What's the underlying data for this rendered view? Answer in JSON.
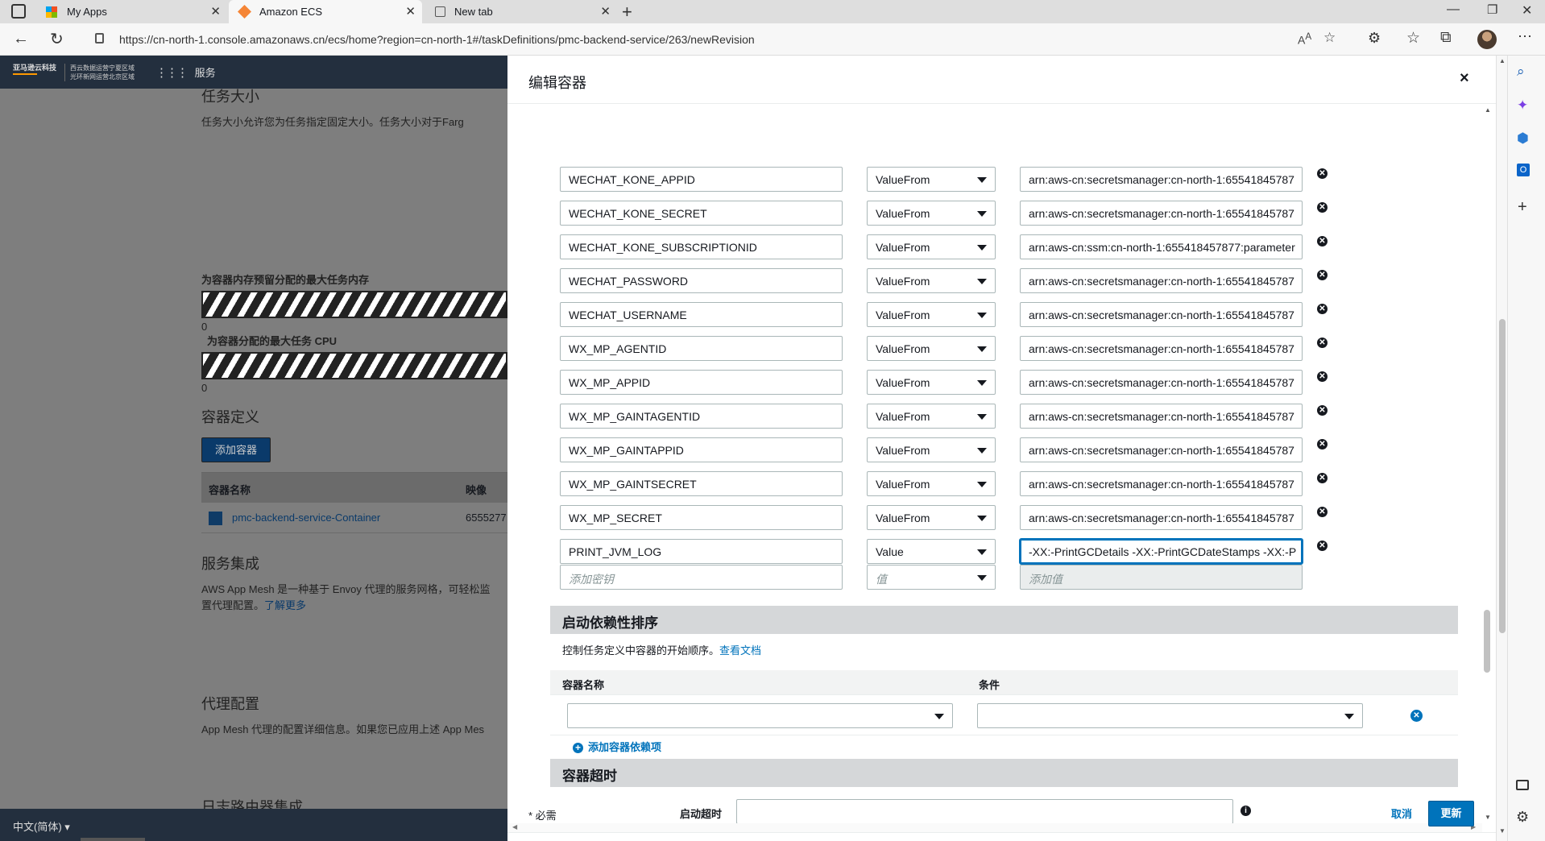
{
  "browser": {
    "tabs": [
      {
        "label": "My Apps"
      },
      {
        "label": "Amazon ECS"
      },
      {
        "label": "New tab"
      }
    ],
    "url": "https://cn-north-1.console.amazonaws.cn/ecs/home?region=cn-north-1#/taskDefinitions/pmc-backend-service/263/newRevision"
  },
  "aws_nav": {
    "logo_line1": "亚马逊云科技",
    "logo_line2a": "西云数据运营宁夏区域",
    "logo_line2b": "光环新网运营北京区域",
    "services": "服务"
  },
  "background": {
    "task_size_title": "任务大小",
    "task_size_desc": "任务大小允许您为任务指定固定大小。任务大小对于Farg",
    "mem_label": "为容器内存预留分配的最大任务内存",
    "mem_value": "0",
    "cpu_label": "为容器分配的最大任务 CPU",
    "cpu_value": "0",
    "container_def_title": "容器定义",
    "add_container": "添加容器",
    "table_col_name": "容器名称",
    "table_col_image": "映像",
    "container_name": "pmc-backend-service-Container",
    "container_image": "6555277",
    "service_integration_title": "服务集成",
    "service_integration_desc1": "AWS App Mesh 是一种基于 Envoy 代理的服务网格，可轻松监",
    "service_integration_desc2": "置代理配置。",
    "learn_more": "了解更多",
    "proxy_title": "代理配置",
    "proxy_desc": "App Mesh 代理的配置详细信息。如果您已应用上述 App Mes",
    "log_router_title": "日志路由器集成",
    "language": "中文(简体)"
  },
  "modal": {
    "title": "编辑容器",
    "close": "×",
    "env_rows": [
      {
        "key": "WECHAT_KONE_APPID",
        "type": "ValueFrom",
        "value": "arn:aws-cn:secretsmanager:cn-north-1:65541845787"
      },
      {
        "key": "WECHAT_KONE_SECRET",
        "type": "ValueFrom",
        "value": "arn:aws-cn:secretsmanager:cn-north-1:65541845787"
      },
      {
        "key": "WECHAT_KONE_SUBSCRIPTIONID",
        "type": "ValueFrom",
        "value": "arn:aws-cn:ssm:cn-north-1:655418457877:parameter"
      },
      {
        "key": "WECHAT_PASSWORD",
        "type": "ValueFrom",
        "value": "arn:aws-cn:secretsmanager:cn-north-1:65541845787"
      },
      {
        "key": "WECHAT_USERNAME",
        "type": "ValueFrom",
        "value": "arn:aws-cn:secretsmanager:cn-north-1:65541845787"
      },
      {
        "key": "WX_MP_AGENTID",
        "type": "ValueFrom",
        "value": "arn:aws-cn:secretsmanager:cn-north-1:65541845787"
      },
      {
        "key": "WX_MP_APPID",
        "type": "ValueFrom",
        "value": "arn:aws-cn:secretsmanager:cn-north-1:65541845787"
      },
      {
        "key": "WX_MP_GAINTAGENTID",
        "type": "ValueFrom",
        "value": "arn:aws-cn:secretsmanager:cn-north-1:65541845787"
      },
      {
        "key": "WX_MP_GAINTAPPID",
        "type": "ValueFrom",
        "value": "arn:aws-cn:secretsmanager:cn-north-1:65541845787"
      },
      {
        "key": "WX_MP_GAINTSECRET",
        "type": "ValueFrom",
        "value": "arn:aws-cn:secretsmanager:cn-north-1:65541845787"
      },
      {
        "key": "WX_MP_SECRET",
        "type": "ValueFrom",
        "value": "arn:aws-cn:secretsmanager:cn-north-1:65541845787"
      },
      {
        "key": "PRINT_JVM_LOG",
        "type": "Value",
        "value": "-XX:-PrintGCDetails -XX:-PrintGCDateStamps -XX:-P"
      }
    ],
    "new_key_placeholder": "添加密钥",
    "new_type_placeholder": "值",
    "new_value_placeholder": "添加值",
    "startup_dep_title": "启动依赖性排序",
    "startup_dep_desc": "控制任务定义中容器的开始顺序。",
    "view_docs": "查看文档",
    "dep_col_container": "容器名称",
    "dep_col_condition": "条件",
    "add_dependency": "添加容器依赖项",
    "timeout_title": "容器超时",
    "start_timeout_label": "启动超时",
    "required_note": "* 必需",
    "cancel": "取消",
    "update": "更新"
  }
}
